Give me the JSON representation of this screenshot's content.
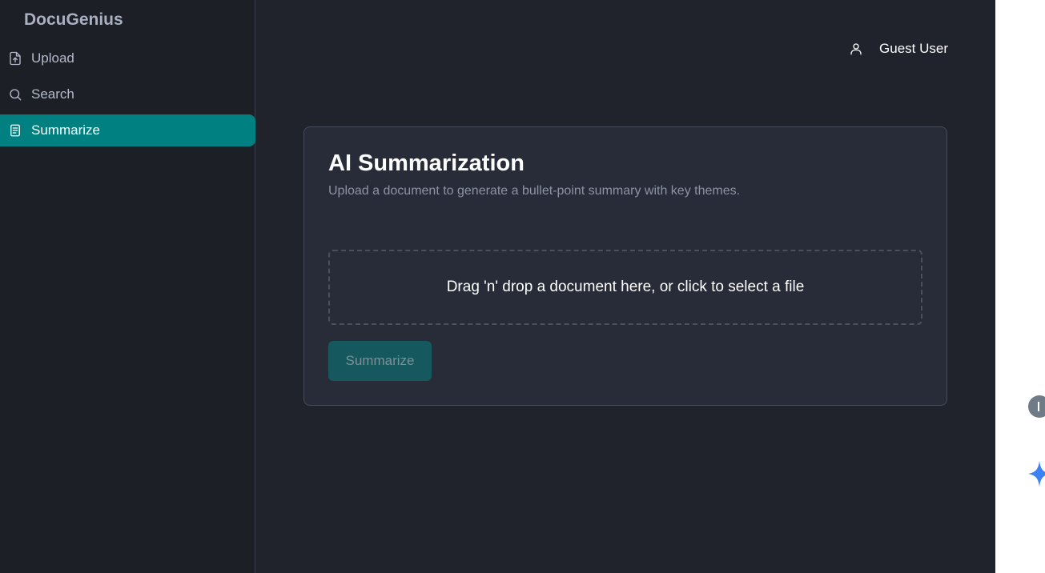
{
  "app": {
    "brand": "DocuGenius"
  },
  "sidebar": {
    "items": [
      {
        "label": "Upload",
        "icon": "file-upload-icon",
        "active": false
      },
      {
        "label": "Search",
        "icon": "search-icon",
        "active": false
      },
      {
        "label": "Summarize",
        "icon": "document-icon",
        "active": true
      }
    ]
  },
  "header": {
    "user_name": "Guest User",
    "user_icon": "user-icon"
  },
  "card": {
    "title": "AI Summarization",
    "subtitle": "Upload a document to generate a bullet-point summary with key themes.",
    "dropzone_text": "Drag 'n' drop a document here, or click to select a file",
    "button_label": "Summarize"
  },
  "colors": {
    "accent": "#008080",
    "sidebar_bg": "#1c1f26",
    "main_bg": "#20232c",
    "card_bg": "#272c38",
    "button_disabled": "#15585e"
  }
}
